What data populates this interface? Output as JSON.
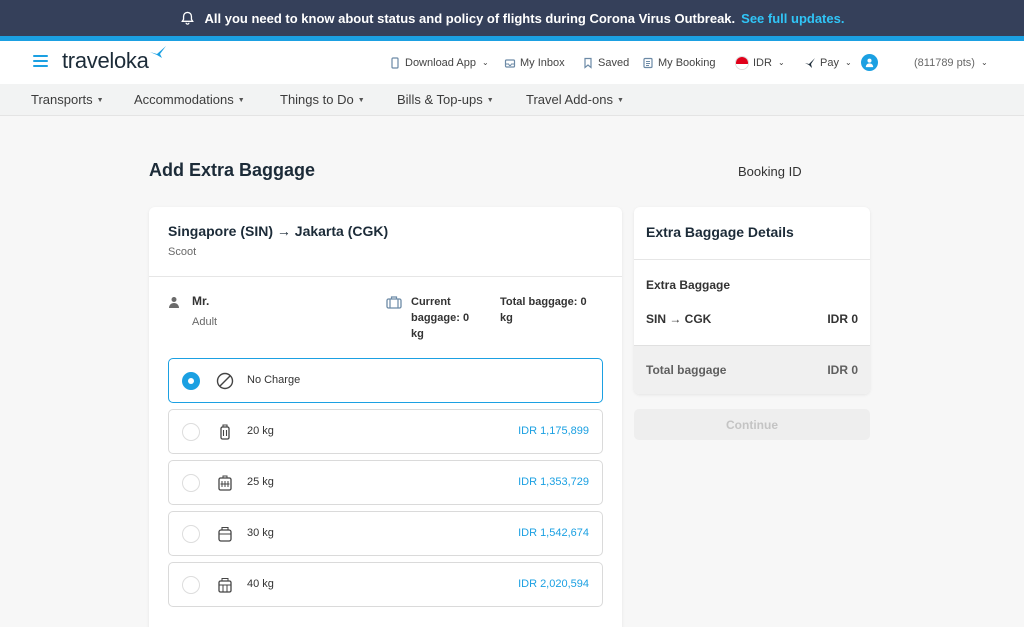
{
  "announcement": {
    "text": "All you need to know about status and policy of flights during Corona Virus Outbreak.",
    "link": "See full updates."
  },
  "header": {
    "logo": "traveloka",
    "download_app": "Download App",
    "inbox": "My Inbox",
    "saved": "Saved",
    "booking": "My Booking",
    "currency": "IDR",
    "pay": "Pay",
    "points": "(811789 pts)"
  },
  "categories": [
    "Transports",
    "Accommodations",
    "Things to Do",
    "Bills & Top-ups",
    "Travel Add-ons"
  ],
  "page": {
    "title": "Add Extra Baggage",
    "booking_id_label": "Booking ID"
  },
  "flight": {
    "route": "Singapore (SIN) → Jakarta (CGK)",
    "airline": "Scoot"
  },
  "passenger": {
    "title": "Mr.",
    "type": "Adult",
    "current_baggage": "Current baggage: 0 kg",
    "total_baggage": "Total baggage: 0 kg"
  },
  "options": [
    {
      "label": "No Charge",
      "price": "",
      "icon": "no-charge-icon",
      "selected": true
    },
    {
      "label": "20 kg",
      "price": "IDR 1,175,899",
      "icon": "luggage-icon",
      "selected": false
    },
    {
      "label": "25 kg",
      "price": "IDR 1,353,729",
      "icon": "suitcase-icon",
      "selected": false
    },
    {
      "label": "30 kg",
      "price": "IDR 1,542,674",
      "icon": "bag-icon",
      "selected": false
    },
    {
      "label": "40 kg",
      "price": "IDR 2,020,594",
      "icon": "box-bag-icon",
      "selected": false
    }
  ],
  "summary": {
    "title": "Extra Baggage Details",
    "subtitle": "Extra Baggage",
    "route": "SIN → CGK",
    "route_value": "IDR 0",
    "total_label": "Total baggage",
    "total_value": "IDR 0",
    "continue": "Continue"
  },
  "colors": {
    "accent": "#1ba0e2",
    "announcement_bg": "#35405a"
  }
}
